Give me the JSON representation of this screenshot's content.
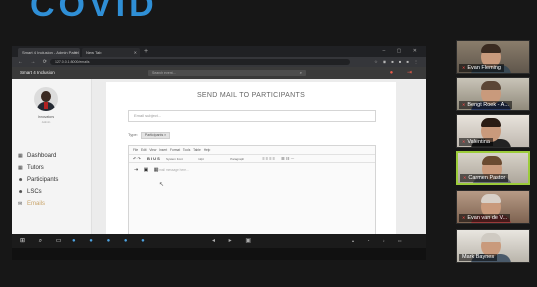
{
  "banner": {
    "text": "COVID"
  },
  "browser": {
    "tabs": [
      {
        "label": "Smart 4 Inclusion - Admin Panel"
      },
      {
        "label": "New Tab"
      }
    ],
    "new_tab_glyph": "+",
    "window_controls": "– ▢ ✕",
    "nav_glyphs": "← → ⟳ ⌂",
    "url": "127.0.0.1:8000/emails",
    "extension_glyphs": "☆ ◉ ■ ■ ■ ⋮"
  },
  "app": {
    "name": "Smart 4 Inclusion",
    "search": {
      "placeholder": "Search event...",
      "icon": "search-icon",
      "glyph": "⌕"
    },
    "header_icons": {
      "glyphs": "● ⇥",
      "color": "#e85b4a"
    }
  },
  "sidebar": {
    "user_name": "Innovators",
    "user_role": "Admin",
    "items": [
      {
        "label": "Dashboard",
        "icon": "dashboard-icon",
        "glyph": "▦",
        "active": false
      },
      {
        "label": "Tutors",
        "icon": "tutors-icon",
        "glyph": "▦",
        "active": false
      },
      {
        "label": "Participants",
        "icon": "participants-icon",
        "glyph": "☻",
        "active": false
      },
      {
        "label": "LSCs",
        "icon": "lscs-icon",
        "glyph": "☻",
        "active": false
      },
      {
        "label": "Emails",
        "icon": "emails-icon",
        "glyph": "✉",
        "active": true
      }
    ]
  },
  "mail_form": {
    "title": "SEND MAIL TO PARTICIPANTS",
    "subject_placeholder": "Email subject...",
    "type_label": "Type:",
    "type_value": "Participants ×",
    "editor_menu": "File  Edit  View  Insert  Format  Tools  Table  Help",
    "editor_toolbar": {
      "undo_redo": "↶ ↷",
      "format_glyphs": "B I U S",
      "font_select": "System Font",
      "size_select": "12pt",
      "block_select": "Paragraph",
      "align_glyphs": "≡ ≡ ≡ ≡",
      "list_glyphs": "☰ ☷ ⋯"
    },
    "editor_tools": "⇥ ▣ ▦",
    "editor_placeholder": "Email message here...",
    "cursor_glyph": "↖",
    "status_left": "p",
    "status_right": "0 WORDS",
    "send_label": "Send ▸"
  },
  "participants": [
    {
      "name": "Evan Fleming",
      "muted": true
    },
    {
      "name": "Bengt Roek - A...",
      "muted": true
    },
    {
      "name": "Valentina",
      "muted": true
    },
    {
      "name": "Carmen Pastor",
      "muted": true
    },
    {
      "name": "Evan van de V...",
      "muted": true
    },
    {
      "name": "Mark Baynes",
      "muted": false
    }
  ],
  "colors": {
    "banner": "#2f8fd6",
    "accent": "#c9a46a",
    "active_speaker_border": "#9ccc3a",
    "muted_mic": "#ff4d4d"
  }
}
